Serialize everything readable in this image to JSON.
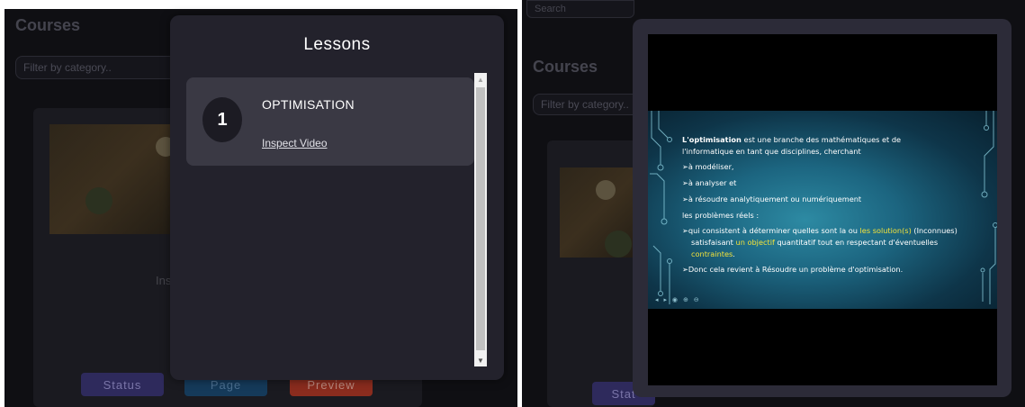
{
  "background": {
    "courses_title": "Courses",
    "filter_placeholder": "Filter by category..",
    "card_text": "Ins",
    "buttons": {
      "status": "Status",
      "page": "Page",
      "preview": "Preview"
    },
    "right": {
      "search_placeholder": "Search",
      "courses_title": "Courses",
      "filter_placeholder": "Filter by category..",
      "status_partial": "Stat"
    }
  },
  "lessons_modal": {
    "title": "Lessons",
    "items": [
      {
        "number": "1",
        "name": "OPTIMISATION",
        "link": "Inspect Video"
      }
    ]
  },
  "video_modal": {
    "slide": {
      "line1_bold": "L'optimisation",
      "line1_rest": " est une branche des mathématiques et de",
      "line2": "l'informatique en tant que disciplines, cherchant",
      "bullet1": "à modéliser,",
      "bullet2": "à analyser et",
      "bullet3": "à résoudre analytiquement ou numériquement",
      "line6": "les problèmes réels :",
      "bullet4_a": "qui consistent à déterminer quelles sont la ou ",
      "bullet4_highlight": "les solution(s)",
      "bullet4_b": " (Inconnues)",
      "line8_a": "satisfaisant ",
      "line8_highlight": "un objectif",
      "line8_b": " quantitatif tout en respectant d'éventuelles",
      "line9_highlight": "contraintes",
      "line9_end": ".",
      "bullet5": "Donc cela revient à Résoudre un problème d'optimisation.",
      "bullet_glyph": "➢",
      "controls": "◂ ▸ ◉ ⊕ ⊖"
    }
  },
  "colors": {
    "slide_highlight": "#f3e23a",
    "modal_bg": "#23222c",
    "lesson_item_bg": "#3a3944",
    "status_btn": "#2e2a5c",
    "page_btn": "#153a5a",
    "preview_btn": "#8a2c1e"
  }
}
